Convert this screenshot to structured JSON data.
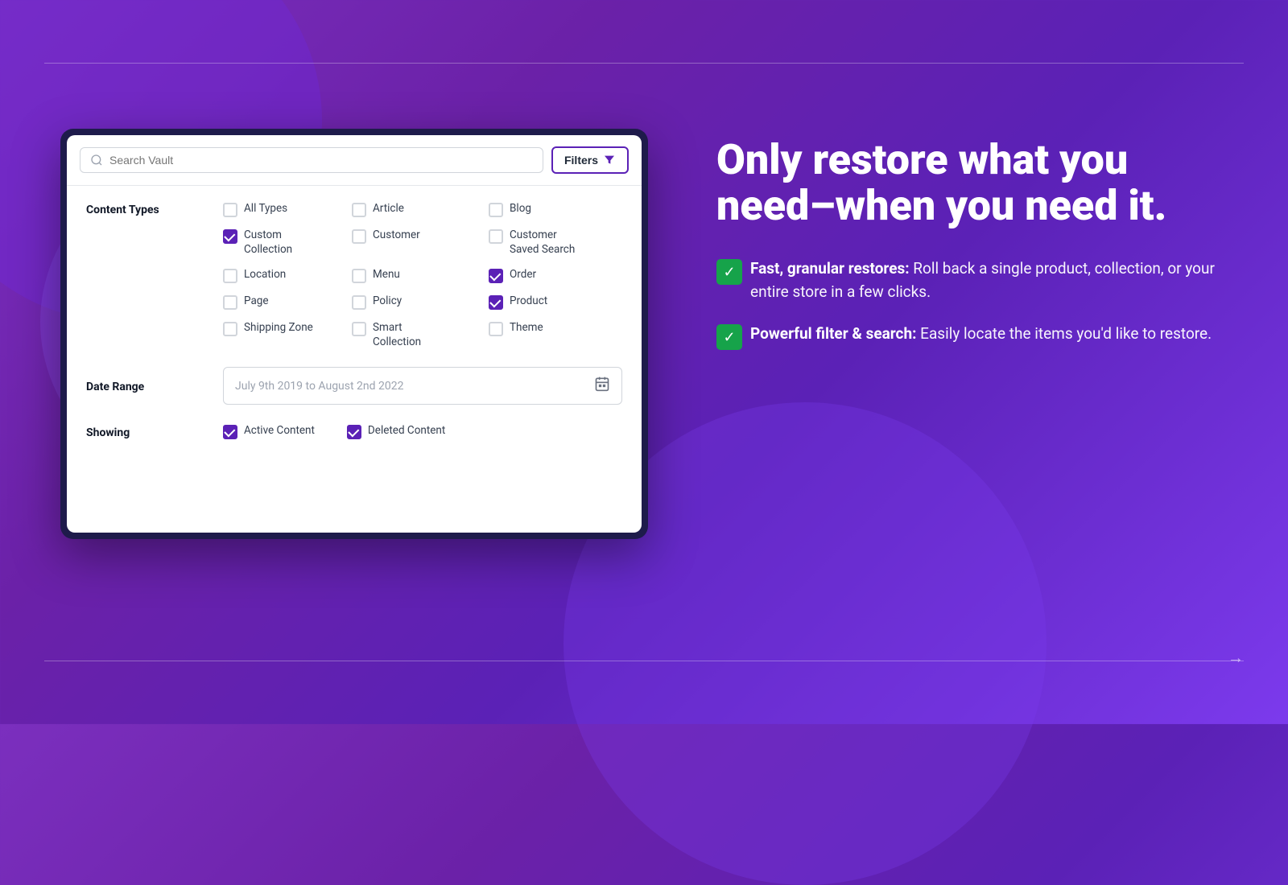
{
  "background": {
    "color": "#7B2FBE"
  },
  "search": {
    "placeholder": "Search Vault",
    "filters_button": "Filters"
  },
  "content_types": {
    "label": "Content Types",
    "items": [
      {
        "id": "all-types",
        "label": "All Types",
        "checked": false
      },
      {
        "id": "article",
        "label": "Article",
        "checked": false
      },
      {
        "id": "blog",
        "label": "Blog",
        "checked": false
      },
      {
        "id": "custom-collection",
        "label": "Custom Collection",
        "checked": true
      },
      {
        "id": "customer",
        "label": "Customer",
        "checked": false
      },
      {
        "id": "customer-saved-search",
        "label": "Customer Saved Search",
        "checked": false
      },
      {
        "id": "location",
        "label": "Location",
        "checked": false
      },
      {
        "id": "menu",
        "label": "Menu",
        "checked": false
      },
      {
        "id": "order",
        "label": "Order",
        "checked": true
      },
      {
        "id": "page",
        "label": "Page",
        "checked": false
      },
      {
        "id": "policy",
        "label": "Policy",
        "checked": false
      },
      {
        "id": "product",
        "label": "Product",
        "checked": true
      },
      {
        "id": "shipping-zone",
        "label": "Shipping Zone",
        "checked": false
      },
      {
        "id": "smart-collection",
        "label": "Smart Collection",
        "checked": false
      },
      {
        "id": "theme",
        "label": "Theme",
        "checked": false
      }
    ]
  },
  "date_range": {
    "label": "Date Range",
    "value": "July 9th 2019 to August 2nd 2022"
  },
  "showing": {
    "label": "Showing",
    "items": [
      {
        "id": "active-content",
        "label": "Active Content",
        "checked": true
      },
      {
        "id": "deleted-content",
        "label": "Deleted Content",
        "checked": true
      }
    ]
  },
  "right_panel": {
    "headline": "Only restore what you need–when you need it.",
    "features": [
      {
        "id": "fast-restores",
        "bold": "Fast, granular restores:",
        "text": " Roll back a single product, collection, or your entire store in a few clicks."
      },
      {
        "id": "filter-search",
        "bold": "Powerful filter & search:",
        "text": " Easily locate the items you'd like to restore."
      }
    ]
  }
}
